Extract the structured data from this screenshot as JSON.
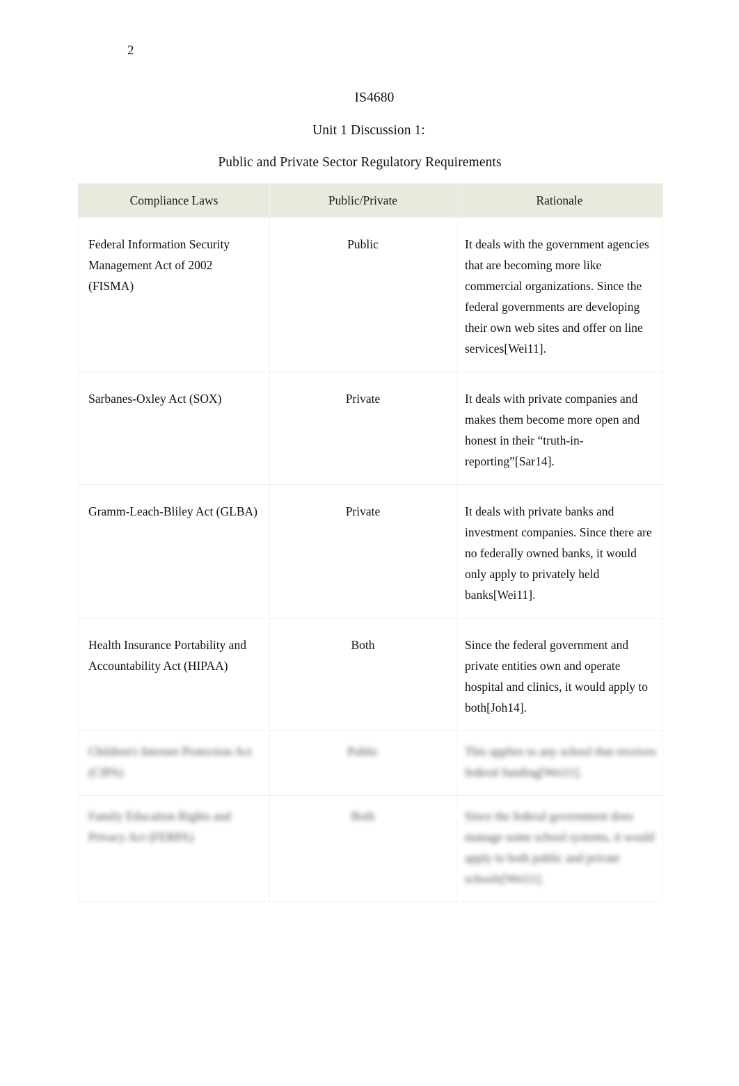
{
  "document": {
    "page_number": "2",
    "headings": [
      "IS4680",
      "Unit 1 Discussion 1:",
      "Public and Private Sector Regulatory Requirements"
    ]
  },
  "table": {
    "columns": [
      "Compliance Laws",
      "Public/Private",
      "Rationale"
    ],
    "rows": [
      {
        "law": "Federal Information Security Management Act of 2002 (FISMA)",
        "type": "Public",
        "rationale": "It deals with the government agencies that are becoming more like commercial organizations. Since the federal governments are developing their own web sites and offer on line services[Wei11].",
        "redacted": false
      },
      {
        "law": "Sarbanes-Oxley Act (SOX)",
        "type": "Private",
        "rationale": "It deals with private companies and makes them become more open and honest in their “truth-in-reporting”[Sar14].",
        "redacted": false
      },
      {
        "law": "Gramm-Leach-Bliley Act (GLBA)",
        "type": "Private",
        "rationale": "It deals with private banks and investment companies. Since there are no federally owned banks, it would only apply to privately held banks[Wei11].",
        "redacted": false
      },
      {
        "law": "Health Insurance Portability and Accountability Act (HIPAA)",
        "type": "Both",
        "rationale": "Since the federal government and private entities own and operate hospital and clinics, it would apply to both[Joh14].",
        "redacted": false
      },
      {
        "law": "Children's Internet Protection Act (CIPA)",
        "type": "Public",
        "rationale": "This applies to any school that receives federal funding[Wei11].",
        "redacted": true
      },
      {
        "law": "Family Education Rights and Privacy Act (FERPA)",
        "type": "Both",
        "rationale": "Since the federal government does manage some school systems, it would apply to both public and private schools[Wei11].",
        "redacted": true
      }
    ]
  },
  "style": {
    "header_background": "#e9e9dd",
    "text_color": "#111111",
    "page_background": "#ffffff"
  }
}
